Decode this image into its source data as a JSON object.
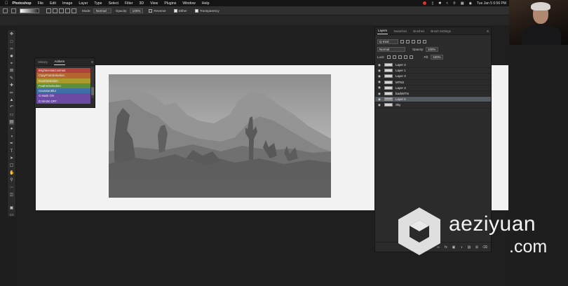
{
  "menubar": {
    "app": "Photoshop",
    "menus": [
      "File",
      "Edit",
      "Image",
      "Layer",
      "Type",
      "Select",
      "Filter",
      "3D",
      "View",
      "Plugins",
      "Window",
      "Help"
    ],
    "datetime": "Tue Jan 5  6:56 PM"
  },
  "options_bar": {
    "mode_label": "Mode:",
    "mode_value": "Normal",
    "opacity_label": "Opacity:",
    "opacity_value": "100%",
    "reverse_label": "Reverse",
    "dither_label": "Dither",
    "transparency_label": "Transparency"
  },
  "actions_panel": {
    "tabs": [
      "History",
      "Actions"
    ],
    "active_tab": "Actions",
    "actions": [
      {
        "label": "Brightness&Contrast",
        "color": "#b0403a"
      },
      {
        "label": "CopyFromSelection",
        "color": "#b5652f"
      },
      {
        "label": "InvertSelection",
        "color": "#a99a2c"
      },
      {
        "label": "FeatherSelection",
        "color": "#5d8f3a"
      },
      {
        "label": "GaussianBlur",
        "color": "#3f6fa6"
      },
      {
        "label": "G Mask ON",
        "color": "#6a4aa3"
      },
      {
        "label": "G MASK OFF",
        "color": "#6a4aa3"
      }
    ]
  },
  "layers_panel": {
    "tabs": [
      "Layers",
      "Swatches",
      "Brushes",
      "Brush Settings"
    ],
    "active_tab": "Layers",
    "filter_kind": "Q Kind",
    "blend_mode": "Normal",
    "opacity_label": "Opacity:",
    "opacity_value": "100%",
    "lock_label": "Lock:",
    "fill_label": "Fill:",
    "fill_value": "100%",
    "layers": [
      {
        "name": "Layer 2",
        "visible": true,
        "selected": false
      },
      {
        "name": "Layer 1",
        "visible": true,
        "selected": false
      },
      {
        "name": "Layer 3",
        "visible": true,
        "selected": false
      },
      {
        "name": "MTN3",
        "visible": true,
        "selected": false
      },
      {
        "name": "Layer 4",
        "visible": true,
        "selected": false
      },
      {
        "name": "backMTN",
        "visible": true,
        "selected": false
      },
      {
        "name": "Layer 5",
        "visible": true,
        "selected": true
      },
      {
        "name": "Sky",
        "visible": true,
        "selected": false
      }
    ]
  },
  "watermark": {
    "line1": "aeziyuan",
    "line2": ".com"
  }
}
